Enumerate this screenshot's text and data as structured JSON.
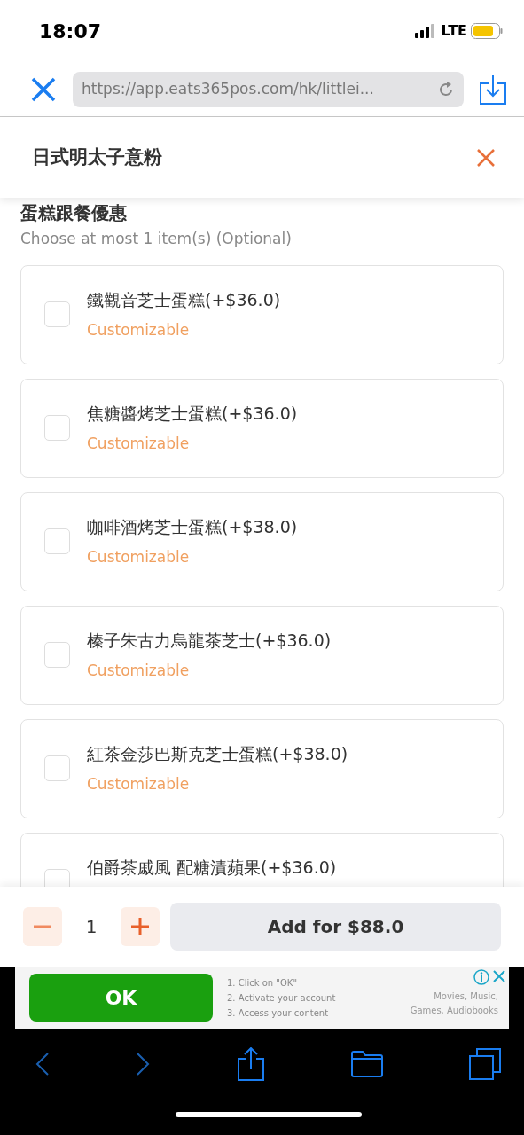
{
  "status_bar": {
    "time": "18:07",
    "network": "LTE"
  },
  "browser": {
    "url": "https://app.eats365pos.com/hk/littlei..."
  },
  "modal": {
    "title": "日式明太子意粉"
  },
  "section": {
    "title": "蛋糕跟餐優惠",
    "hint": "Choose at most 1 item(s) (Optional)"
  },
  "options": [
    {
      "label": "鐵觀音芝士蛋糕(+$36.0)",
      "note": "Customizable",
      "checked": false
    },
    {
      "label": "焦糖醬烤芝士蛋糕(+$36.0)",
      "note": "Customizable",
      "checked": false
    },
    {
      "label": "咖啡酒烤芝士蛋糕(+$38.0)",
      "note": "Customizable",
      "checked": false
    },
    {
      "label": "榛子朱古力烏龍茶芝士(+$36.0)",
      "note": "Customizable",
      "checked": false
    },
    {
      "label": "紅茶金莎巴斯克芝士蛋糕(+$38.0)",
      "note": "Customizable",
      "checked": false
    },
    {
      "label": "伯爵茶戚風 配糖漬蘋果(+$36.0)",
      "checked": false
    }
  ],
  "footer": {
    "quantity": "1",
    "add_button": "Add for $88.0"
  },
  "ad": {
    "button": "OK",
    "steps": [
      "1. Click on \"OK\"",
      "2. Activate your account",
      "3. Access your content"
    ],
    "tagline": [
      "Movies, Music,",
      "Games, Audiobooks"
    ]
  }
}
